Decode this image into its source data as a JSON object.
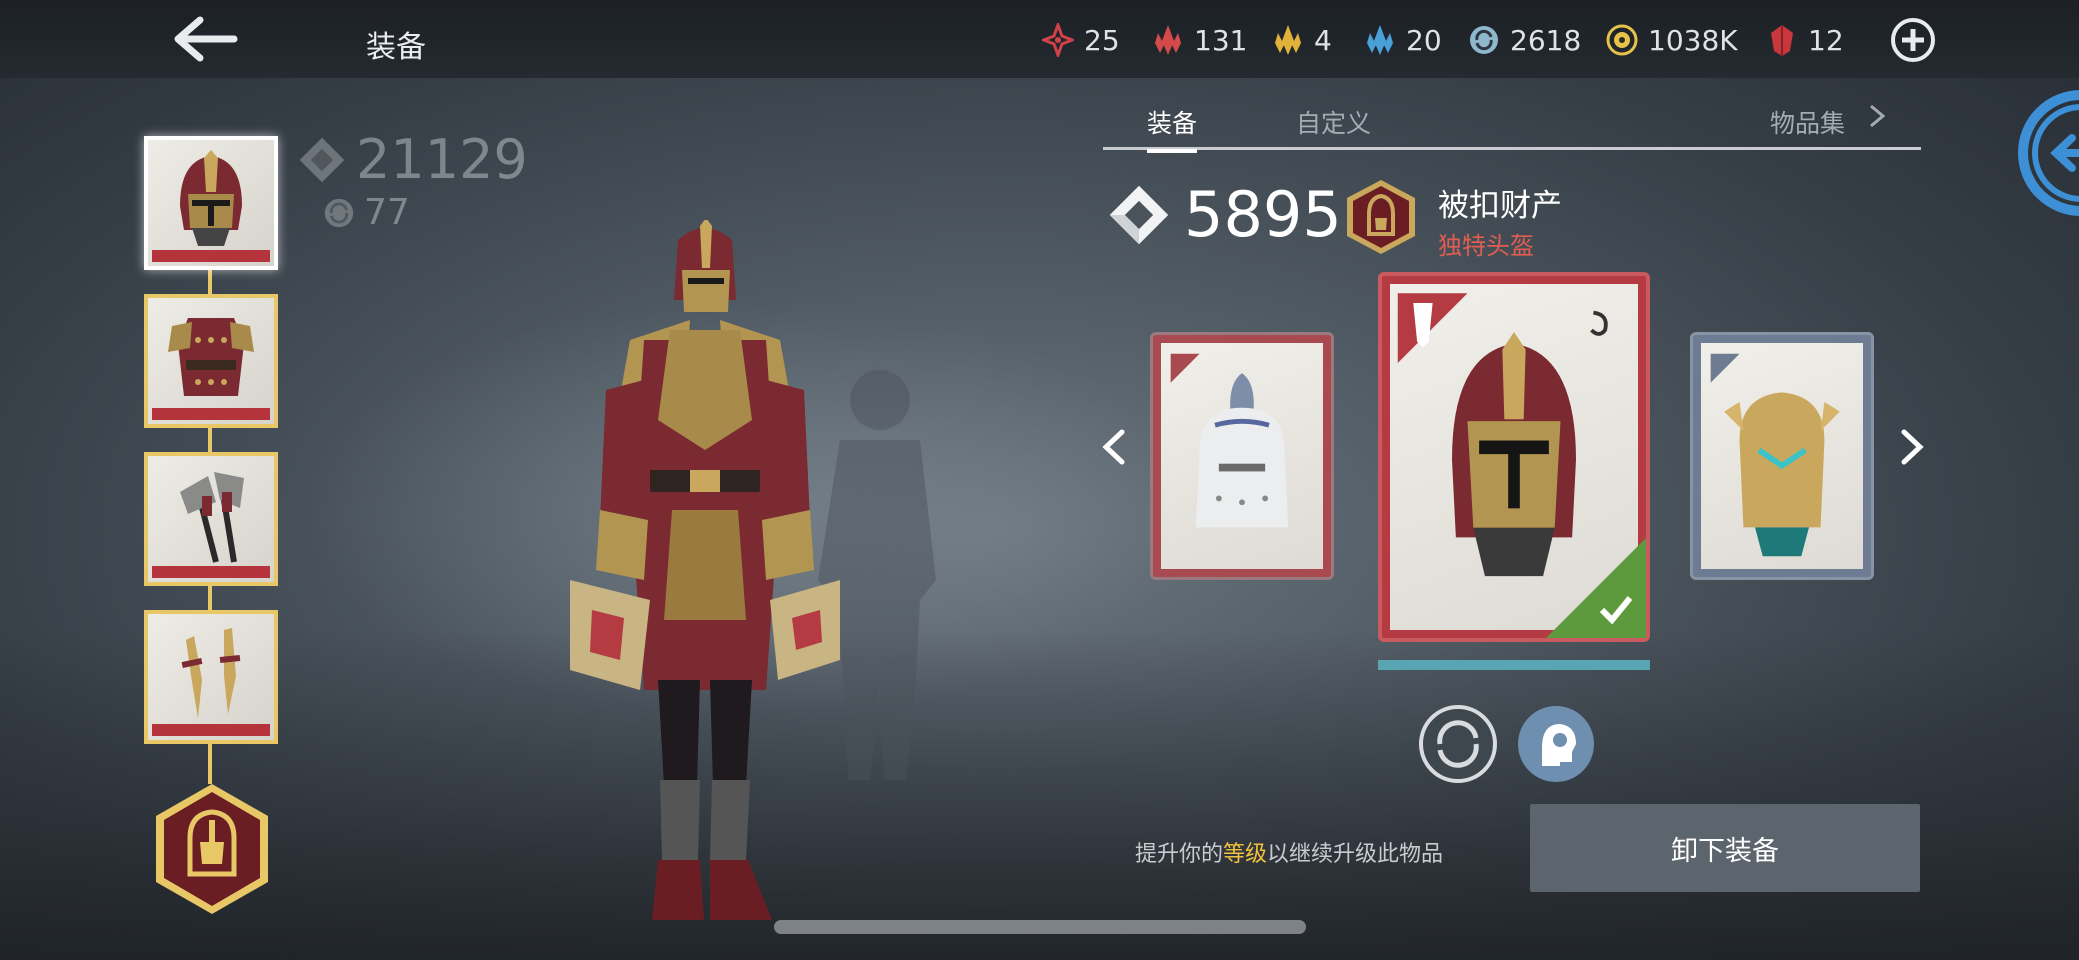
{
  "header": {
    "title": "装备",
    "resources": [
      {
        "icon": "red-star-crystal-icon",
        "value": "25",
        "color": "#d0424a"
      },
      {
        "icon": "red-shard-icon",
        "value": "131",
        "color": "#d44a4a"
      },
      {
        "icon": "gold-shard-icon",
        "value": "4",
        "color": "#e0b23a"
      },
      {
        "icon": "blue-shard-icon",
        "value": "20",
        "color": "#4aa0d8"
      },
      {
        "icon": "swirl-coin-icon",
        "value": "2618",
        "color": "#8fb8cc"
      },
      {
        "icon": "gold-coin-icon",
        "value": "1038K",
        "color": "#e6c24a"
      },
      {
        "icon": "ruby-gem-icon",
        "value": "12",
        "color": "#c8373b"
      }
    ]
  },
  "character": {
    "power": "21129",
    "level": "77"
  },
  "tabs": {
    "equipment": "装备",
    "custom": "自定义",
    "collection": "物品集"
  },
  "item": {
    "power": "5895",
    "name": "被扣财产",
    "type": "独特头盔",
    "rarity_color": "#b33b41",
    "upgrade_progress": 1.0
  },
  "hint": {
    "prefix": "提升你的",
    "highlight": "等级",
    "suffix": "以继续升级此物品"
  },
  "actions": {
    "unequip": "卸下装备"
  }
}
